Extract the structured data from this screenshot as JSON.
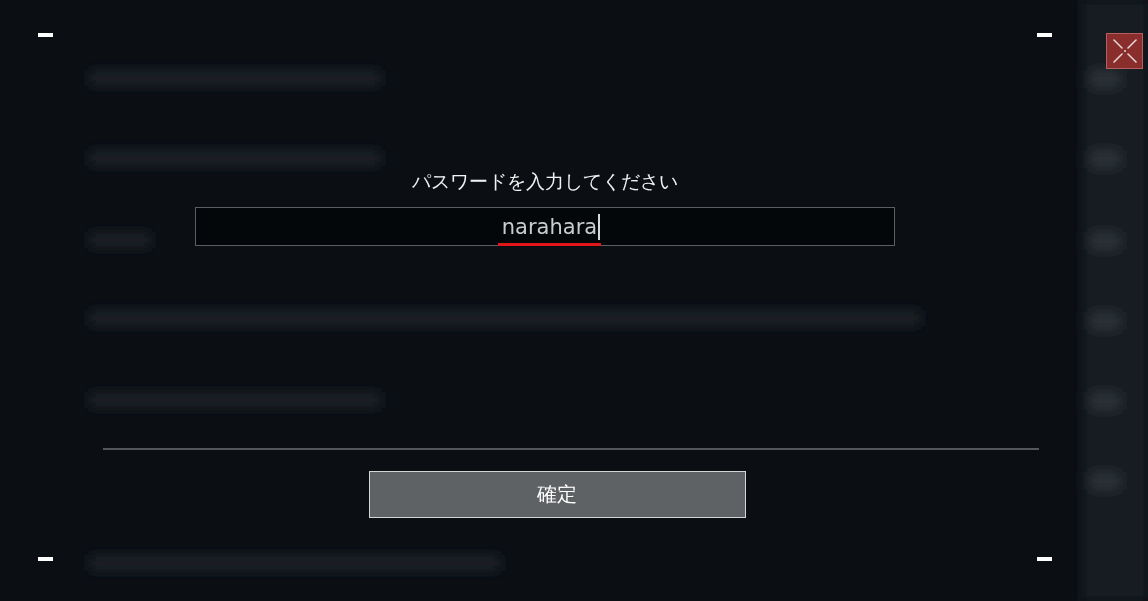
{
  "dialog": {
    "title": "パスワードを入力してください",
    "password_field": {
      "value": "narahara",
      "composing": true,
      "focused": true
    },
    "confirm_button": {
      "label": "確定"
    }
  },
  "close_button": {
    "visible": true
  }
}
